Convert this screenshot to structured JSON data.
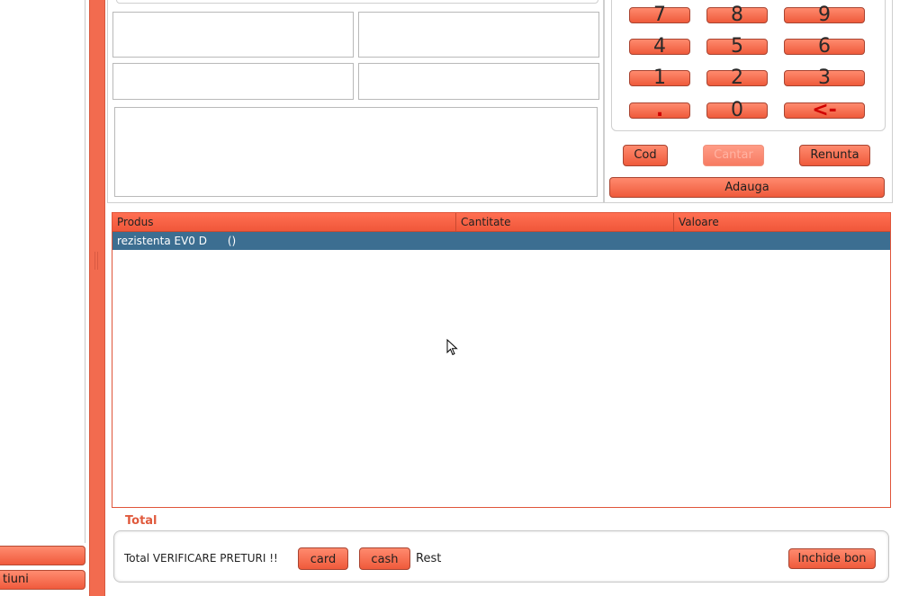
{
  "left_panel": {
    "bottom_buttons": [
      "",
      "tiuni"
    ]
  },
  "keypad": {
    "rows": [
      [
        "7",
        "8",
        "9"
      ],
      [
        "4",
        "5",
        "6"
      ],
      [
        "1",
        "2",
        "3"
      ],
      [
        ".",
        "0",
        "<-"
      ]
    ],
    "cod_label": "Cod",
    "cantar_label": "Cantar",
    "renunta_label": "Renunta",
    "adauga_label": "Adauga"
  },
  "table": {
    "headers": [
      "Produs",
      "Cantitate",
      "Valoare"
    ],
    "rows": [
      {
        "produs": "rezistenta EV0 D      ()",
        "cantitate": "",
        "valoare": ""
      }
    ]
  },
  "total": {
    "section_label": "Total",
    "status_text": "Total VERIFICARE PRETURI !!",
    "card_label": "card",
    "cash_label": "cash",
    "rest_label": "Rest",
    "close_label": "Inchide bon"
  },
  "colors": {
    "accent": "#f26b4f",
    "selection": "#3c6e91"
  }
}
